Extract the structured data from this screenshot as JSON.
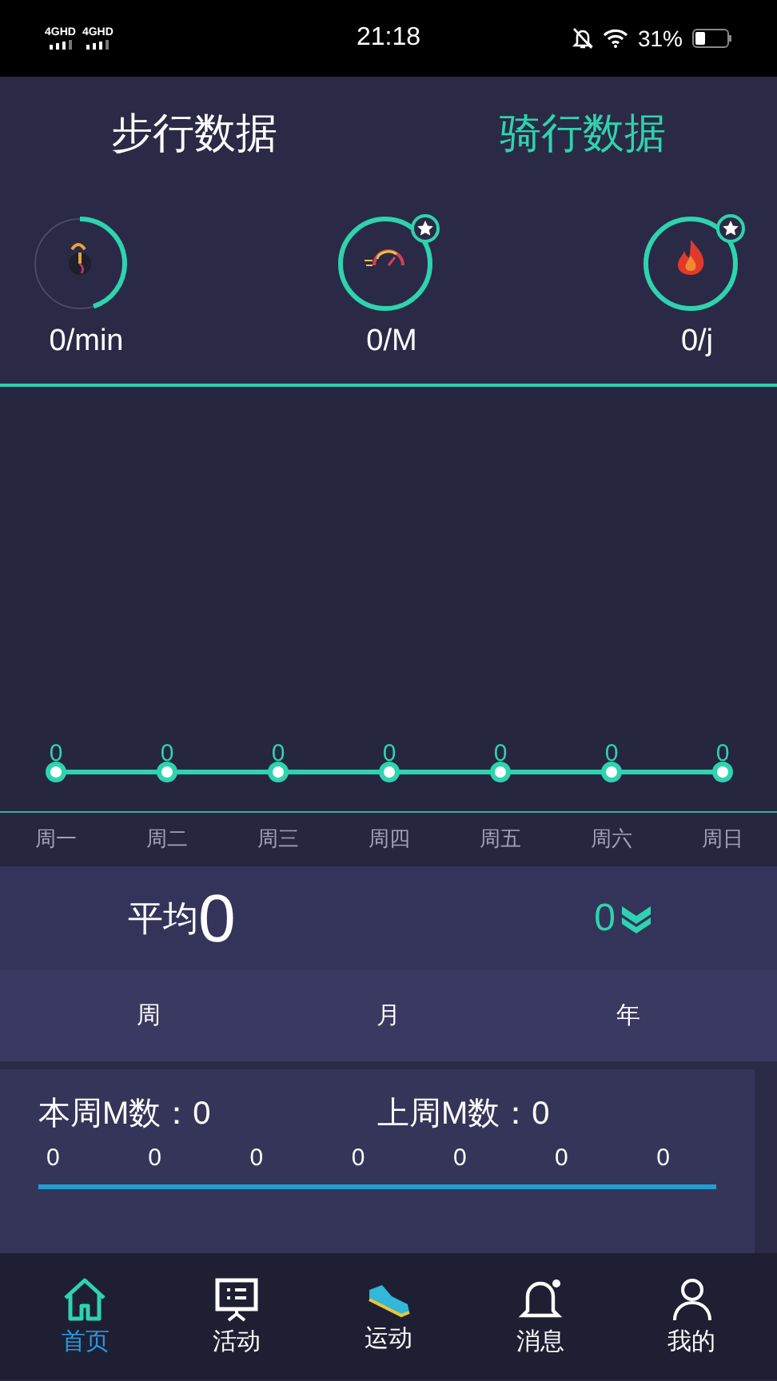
{
  "status_bar": {
    "networks": [
      "4GHD",
      "4GHD"
    ],
    "time": "21:18",
    "battery": "31%"
  },
  "tabs": [
    {
      "label": "步行数据",
      "selected": false
    },
    {
      "label": "骑行数据",
      "selected": true
    }
  ],
  "stats": [
    {
      "kind": "timer",
      "value": "0/min",
      "level": 0.45,
      "starred": false
    },
    {
      "kind": "speed",
      "value": "0/M",
      "level": 1,
      "starred": true
    },
    {
      "kind": "calories",
      "value": "0/j",
      "level": 1,
      "starred": true
    }
  ],
  "daily": {
    "values": [
      "0",
      "0",
      "0",
      "0",
      "0",
      "0",
      "0"
    ],
    "days": [
      "周一",
      "周二",
      "周三",
      "周四",
      "周五",
      "周六",
      "周日"
    ]
  },
  "average": {
    "label": "平均",
    "value": "0",
    "change": "0"
  },
  "periods": [
    "周",
    "月",
    "年"
  ],
  "week_card": {
    "this_week": "本周M数：0",
    "last_week": "上周M数：0",
    "values": [
      "0",
      "0",
      "0",
      "0",
      "0",
      "0",
      "0"
    ]
  },
  "nav": [
    {
      "kind": "home",
      "label": "首页",
      "selected": true
    },
    {
      "kind": "activity",
      "label": "活动",
      "selected": false
    },
    {
      "kind": "sport",
      "label": "运动",
      "selected": false
    },
    {
      "kind": "message",
      "label": "消息",
      "selected": false
    },
    {
      "kind": "profile",
      "label": "我的",
      "selected": false
    }
  ]
}
